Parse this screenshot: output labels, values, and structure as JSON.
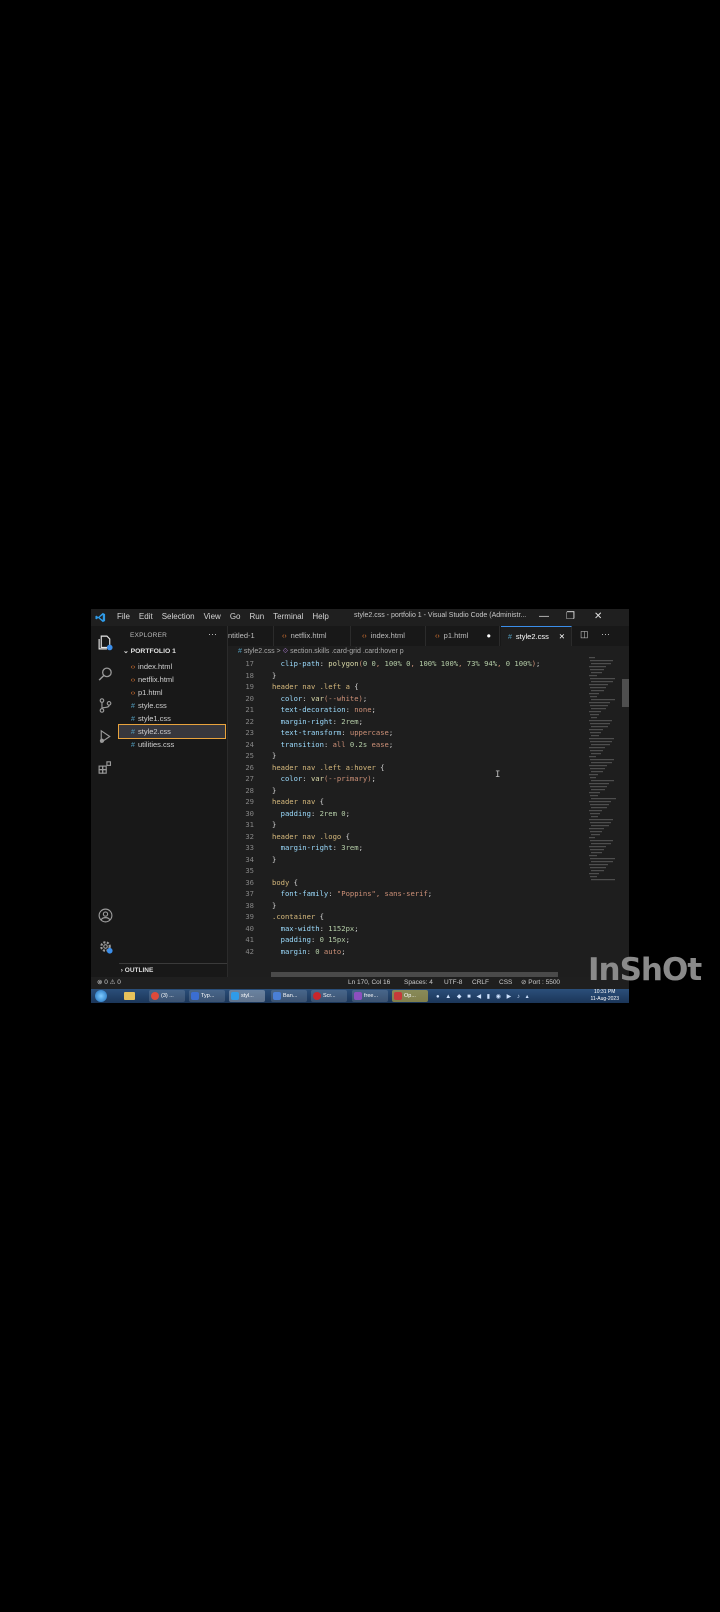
{
  "title_bar": {
    "menu": [
      "File",
      "Edit",
      "Selection",
      "View",
      "Go",
      "Run",
      "Terminal",
      "Help"
    ],
    "window_title": "style2.css - portfolio 1 - Visual Studio Code (Administr...",
    "controls": [
      "—",
      "❐",
      "✕"
    ]
  },
  "activity_bar": {
    "icons": [
      "explorer-icon",
      "search-icon",
      "source-control-icon",
      "run-debug-icon",
      "extensions-icon",
      "account-icon",
      "settings-gear-icon"
    ],
    "explorer_badge": "1",
    "settings_badge": "1"
  },
  "sidebar": {
    "header": "EXPLORER",
    "more": "···",
    "folder": "PORTFOLIO 1",
    "files": [
      {
        "name": "index.html",
        "type": "html"
      },
      {
        "name": "netflix.html",
        "type": "html"
      },
      {
        "name": "p1.html",
        "type": "html"
      },
      {
        "name": "style.css",
        "type": "css"
      },
      {
        "name": "style1.css",
        "type": "css"
      },
      {
        "name": "style2.css",
        "type": "css",
        "selected": true
      },
      {
        "name": "utilities.css",
        "type": "css"
      }
    ],
    "outline": "OUTLINE"
  },
  "tabs": [
    {
      "label": "ntitled-1",
      "icon": ""
    },
    {
      "label": "netflix.html",
      "icon": "<>"
    },
    {
      "label": "index.html",
      "icon": "<>"
    },
    {
      "label": "p1.html",
      "icon": "<>",
      "modified": true
    },
    {
      "label": "style2.css",
      "icon": "#",
      "active": true,
      "close": "✕"
    }
  ],
  "breadcrumbs": {
    "file": "style2.css",
    "separator": ">",
    "symbol": "section.skills .card-grid .card:hover p"
  },
  "editor": {
    "lines": [
      {
        "n": "17",
        "text": "  clip-path: polygon(0 0, 100% 0, 100% 100%, 73% 94%, 0 100%);"
      },
      {
        "n": "18",
        "text": "}"
      },
      {
        "n": "19",
        "text": "header nav .left a {"
      },
      {
        "n": "20",
        "text": "  color: var(--white);"
      },
      {
        "n": "21",
        "text": "  text-decoration: none;"
      },
      {
        "n": "22",
        "text": "  margin-right: 2rem;"
      },
      {
        "n": "23",
        "text": "  text-transform: uppercase;"
      },
      {
        "n": "24",
        "text": "  transition: all 0.2s ease;"
      },
      {
        "n": "25",
        "text": "}"
      },
      {
        "n": "26",
        "text": "header nav .left a:hover {"
      },
      {
        "n": "27",
        "text": "  color: var(--primary);"
      },
      {
        "n": "28",
        "text": "}"
      },
      {
        "n": "29",
        "text": "header nav {"
      },
      {
        "n": "30",
        "text": "  padding: 2rem 0;"
      },
      {
        "n": "31",
        "text": "}"
      },
      {
        "n": "32",
        "text": "header nav .logo {"
      },
      {
        "n": "33",
        "text": "  margin-right: 3rem;"
      },
      {
        "n": "34",
        "text": "}"
      },
      {
        "n": "35",
        "text": ""
      },
      {
        "n": "36",
        "text": "body {"
      },
      {
        "n": "37",
        "text": "  font-family: \"Poppins\", sans-serif;"
      },
      {
        "n": "38",
        "text": "}"
      },
      {
        "n": "39",
        "text": ".container {"
      },
      {
        "n": "40",
        "text": "  max-width: 1152px;"
      },
      {
        "n": "41",
        "text": "  padding: 0 15px;"
      },
      {
        "n": "42",
        "text": "  margin: 0 auto;"
      }
    ]
  },
  "status_bar": {
    "problems": "⊗ 0 ⚠ 0",
    "position": "Ln 170, Col 16",
    "spaces": "Spaces: 4",
    "encoding": "UTF-8",
    "eol": "CRLF",
    "language": "CSS",
    "port": "⊘ Port : 5500"
  },
  "taskbar": {
    "items": [
      "(3) ...",
      "Typ...",
      "styl...",
      "Ban...",
      "Scr...",
      "free...",
      "Op..."
    ],
    "time": "10:31 PM",
    "date": "11-Aug-2023"
  },
  "watermark": "InShOt",
  "colors": {
    "accent": "#3b8eea",
    "selection_outline": "#e8a33d",
    "editor_bg": "#1e1e1e",
    "selector": "#d7ba7d",
    "property": "#9cdcfe",
    "string_value": "#ce9178"
  }
}
